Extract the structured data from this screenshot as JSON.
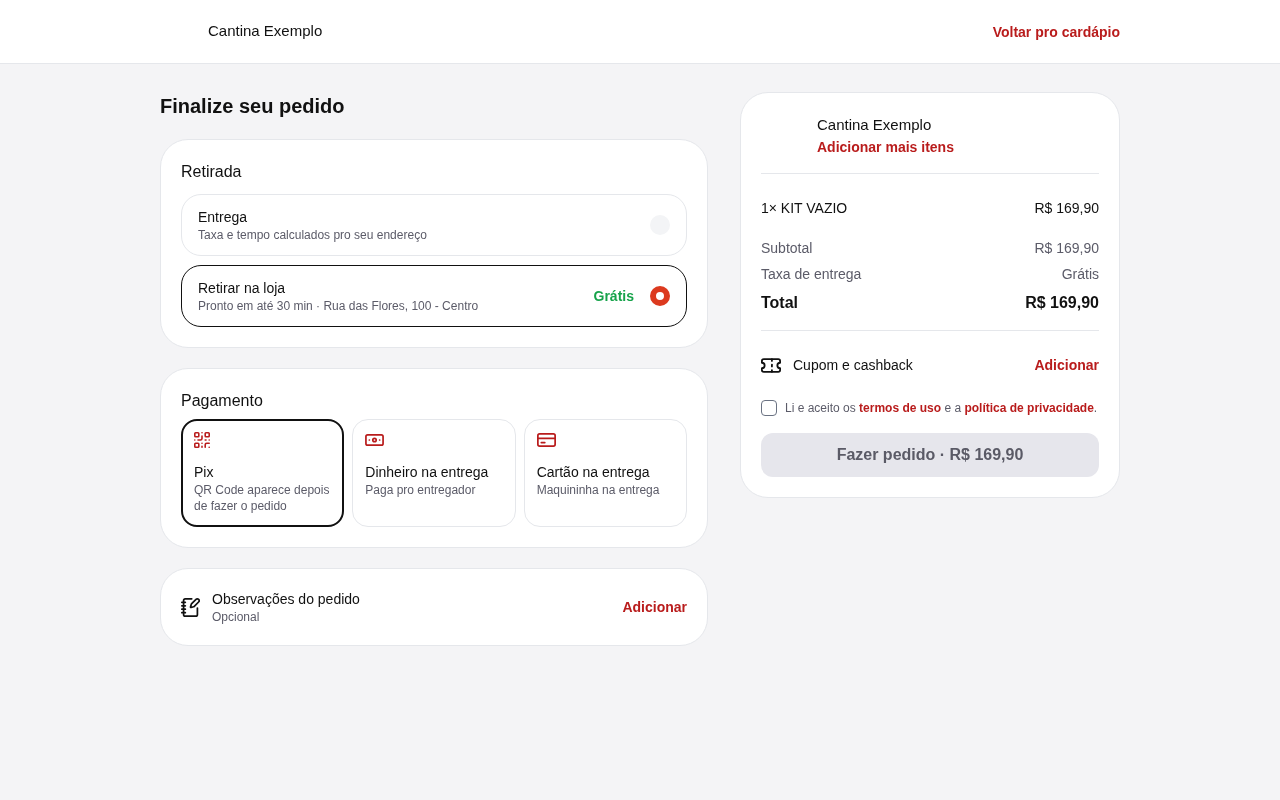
{
  "header": {
    "brand": "Cantina Exemplo",
    "back_link": "Voltar pro cardápio"
  },
  "title": "Finalize seu pedido",
  "fulfillment": {
    "title": "Retirada",
    "options": [
      {
        "label": "Entrega",
        "description": "Taxa e tempo calculados pro seu endereço",
        "selected": false
      },
      {
        "label": "Retirar na loja",
        "description": "Pronto em até 30 min · Rua das Flores, 100 - Centro",
        "price": "Grátis",
        "selected": true
      }
    ]
  },
  "payment": {
    "title": "Pagamento",
    "methods": [
      {
        "kind": "qr",
        "label": "Pix",
        "description": "QR Code aparece depois de fazer o pedido",
        "selected": true
      },
      {
        "kind": "cash",
        "label": "Dinheiro na entrega",
        "description": "Paga pro entregador",
        "selected": false
      },
      {
        "kind": "card",
        "label": "Cartão na entrega",
        "description": "Maquininha na entrega",
        "selected": false
      }
    ]
  },
  "notes": {
    "label": "Observações do pedido",
    "hint": "Opcional",
    "action": "Adicionar"
  },
  "summary": {
    "store": "Cantina Exemplo",
    "add_more": "Adicionar mais itens",
    "items": [
      {
        "name": "1× KIT VAZIO",
        "price": "R$ 169,90"
      }
    ],
    "totals": [
      {
        "kind": "line",
        "label": "Subtotal",
        "value": "R$ 169,90"
      },
      {
        "kind": "line",
        "label": "Taxa de entrega",
        "value": "Grátis"
      },
      {
        "kind": "total",
        "label": "Total",
        "value": "R$ 169,90"
      }
    ],
    "coupon": {
      "label": "Cupom e cashback",
      "action": "Adicionar"
    },
    "terms": {
      "checked": false,
      "parts": [
        {
          "kind": "text",
          "text": "Li e aceito os "
        },
        {
          "kind": "link",
          "text": "termos de uso"
        },
        {
          "kind": "text",
          "text": " e a "
        },
        {
          "kind": "link",
          "text": "política de privacidade"
        },
        {
          "kind": "text",
          "text": "."
        }
      ]
    },
    "submit": {
      "label": "Fazer pedido · R$ 169,90",
      "disabled": true
    }
  }
}
